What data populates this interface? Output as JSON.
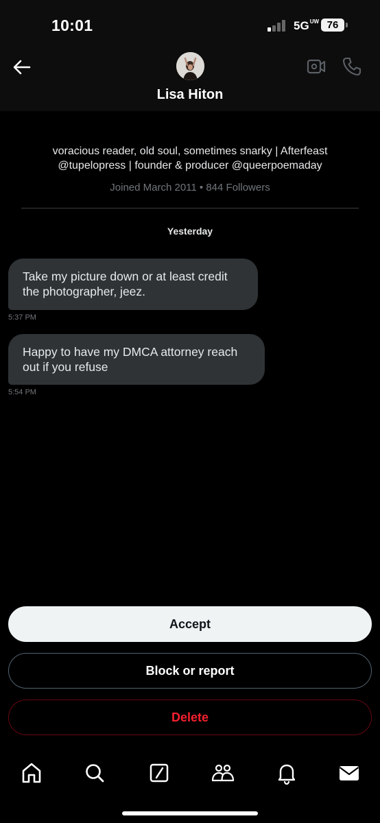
{
  "status_bar": {
    "time": "10:01",
    "network": "5G",
    "network_suffix": "UW",
    "battery": "76"
  },
  "header": {
    "contact_name": "Lisa Hiton",
    "icons": [
      "back-arrow-icon",
      "video-call-icon",
      "phone-icon"
    ]
  },
  "profile": {
    "bio_line1": "voracious reader, old soul, sometimes snarky | Afterfeast",
    "bio_line2": "@tupelopress | founder & producer @queerpoemaday",
    "joined": "Joined March 2011 • 844 Followers"
  },
  "conversation": {
    "date_separator": "Yesterday",
    "messages": [
      {
        "line1": "Take my picture down or at least credit",
        "line2": "the photographer, jeez.",
        "time": "5:37 PM"
      },
      {
        "line1": "Happy to have my DMCA attorney reach",
        "line2": "out if you refuse",
        "time": "5:54 PM"
      }
    ]
  },
  "actions": {
    "accept": "Accept",
    "block_or_report": "Block or report",
    "delete": "Delete"
  },
  "tab_bar": {
    "icons": [
      "home-icon",
      "search-icon",
      "grok-icon",
      "communities-icon",
      "notifications-icon",
      "messages-icon"
    ]
  },
  "colors": {
    "background": "#000000",
    "bubble": "#2f3336",
    "muted_text": "#71767b",
    "delete_red": "#f4212e",
    "accept_bg": "#eff3f4"
  }
}
